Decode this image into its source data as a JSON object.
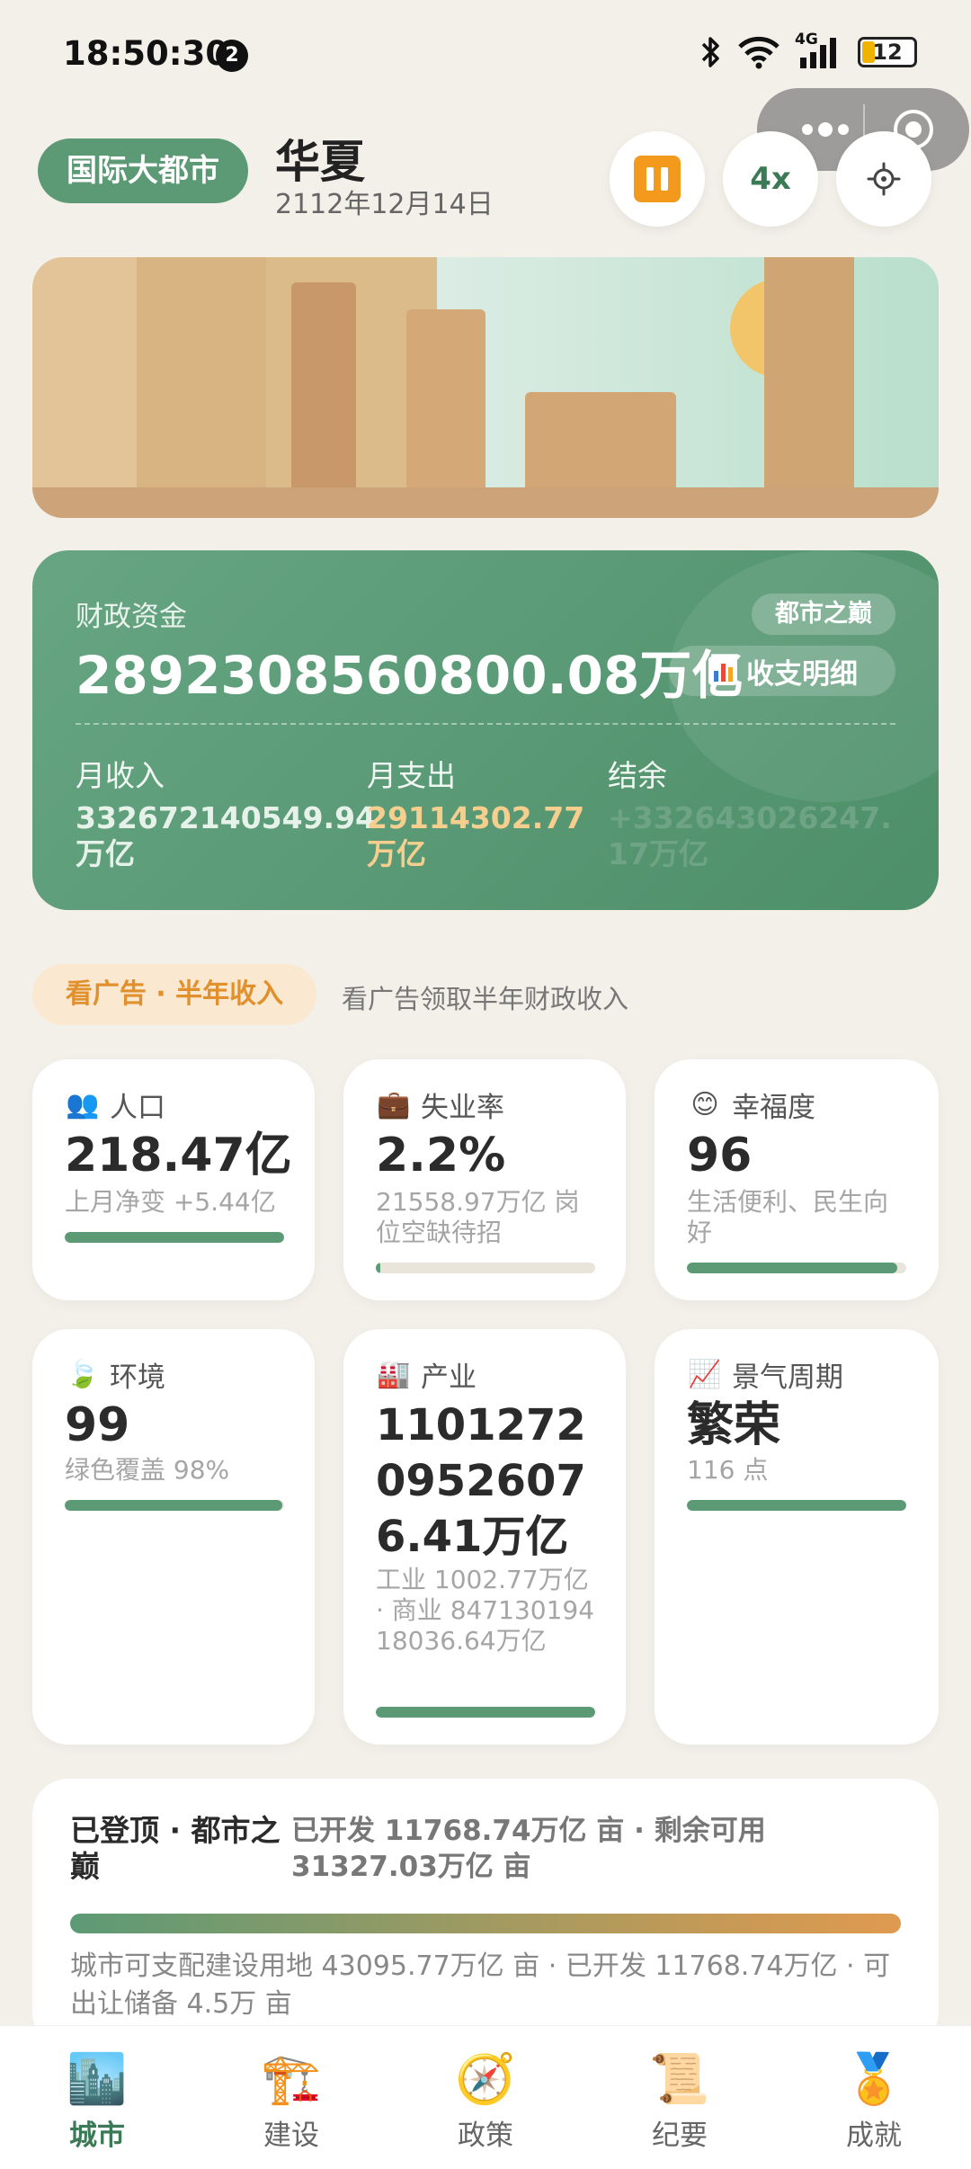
{
  "status_bar": {
    "time": "18:50:30",
    "notification_count": "2",
    "network": "4G",
    "battery_level": "12",
    "icons": [
      "bluetooth-icon",
      "wifi-icon",
      "signal-icon",
      "battery-icon"
    ]
  },
  "header": {
    "city_badge": "国际大都市",
    "city_name": "华夏",
    "date": "2112年12月14日",
    "speed_label": "4x",
    "buttons": [
      "pause-icon",
      "speed",
      "settings-icon"
    ]
  },
  "finance": {
    "label": "财政资金",
    "amount": "2892308560800.08万亿",
    "tag": "都市之巅",
    "detail_button": "收支明细",
    "income_label": "月收入",
    "income_value": "332672140549.94万亿",
    "expense_label": "月支出",
    "expense_value": "29114302.77万亿",
    "balance_label": "结余",
    "balance_value": "+332643026247.17万亿"
  },
  "ad": {
    "pill": "看广告 · 半年收入",
    "text": "看广告领取半年财政收入"
  },
  "stats": [
    {
      "icon": "people-icon",
      "title": "人口",
      "value": "218.47亿",
      "sub": "上月净变 +5.44亿",
      "level": 1.0
    },
    {
      "icon": "briefcase-icon",
      "title": "失业率",
      "value": "2.2%",
      "sub": "21558.97万亿 岗位空缺待招",
      "level": 0.02
    },
    {
      "icon": "smile-icon",
      "title": "幸福度",
      "value": "96",
      "sub": "生活便利、民生向好",
      "level": 0.96
    },
    {
      "icon": "leaf-icon",
      "title": "环境",
      "value": "99",
      "sub": "绿色覆盖 98%",
      "level": 0.99
    },
    {
      "icon": "factory-icon",
      "title": "产业",
      "value": "11012720952607 6.41万亿",
      "sub": "工业 1002.77万亿 · 商业 84713019418036.64万亿",
      "level": 1.0
    },
    {
      "icon": "trend-up-icon",
      "title": "景气周期",
      "value": "繁荣",
      "sub": "116 点",
      "level": 1.0
    }
  ],
  "land": {
    "title": "已登顶 · 都市之巅",
    "summary": "已开发 11768.74万亿 亩 · 剩余可用 31327.03万亿 亩",
    "description": "城市可支配建设用地 43095.77万亿 亩 · 已开发 11768.74万亿 · 可出让储备 4.5万 亩"
  },
  "tabbar": [
    {
      "icon": "city-icon",
      "label": "城市",
      "active": true
    },
    {
      "icon": "crane-icon",
      "label": "建设",
      "active": false
    },
    {
      "icon": "compass-icon",
      "label": "政策",
      "active": false
    },
    {
      "icon": "scroll-icon",
      "label": "纪要",
      "active": false
    },
    {
      "icon": "medal-icon",
      "label": "成就",
      "active": false
    }
  ]
}
